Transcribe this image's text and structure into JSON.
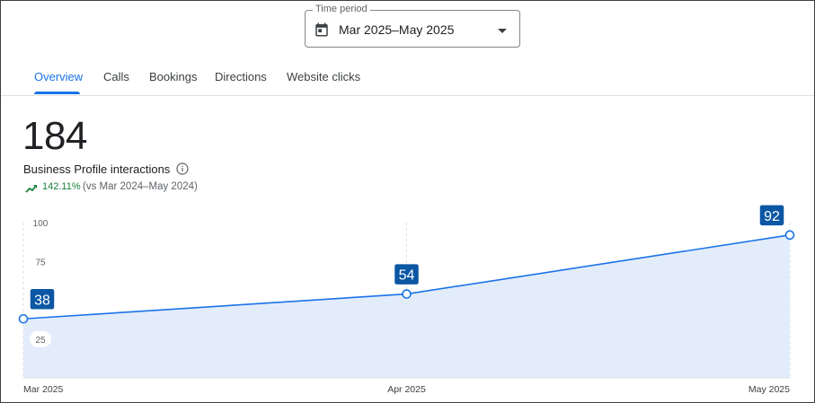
{
  "time_period": {
    "label": "Time period",
    "value": "Mar 2025–May 2025",
    "icon": "calendar-icon"
  },
  "tabs": [
    {
      "label": "Overview",
      "active": true
    },
    {
      "label": "Calls",
      "active": false
    },
    {
      "label": "Bookings",
      "active": false
    },
    {
      "label": "Directions",
      "active": false
    },
    {
      "label": "Website clicks",
      "active": false
    }
  ],
  "metric": {
    "value": "184",
    "label": "Business Profile interactions",
    "change_pct": "142.11%",
    "comparison": "(vs Mar 2024–May 2024)"
  },
  "colors": {
    "accent": "#1a73e8",
    "positive": "#188038",
    "line": "#1a73e8",
    "area_fill": "#e3ecfb",
    "label_bg": "#0b57a4"
  },
  "chart_data": {
    "type": "area",
    "x": [
      "Mar 2025",
      "Apr 2025",
      "May 2025"
    ],
    "series": [
      {
        "values": [
          38,
          54,
          92
        ]
      }
    ],
    "data_labels": [
      "38",
      "54",
      "92"
    ],
    "y_ticks": [
      "100",
      "75",
      "25"
    ],
    "ylim": [
      0,
      100
    ],
    "grid": true
  }
}
